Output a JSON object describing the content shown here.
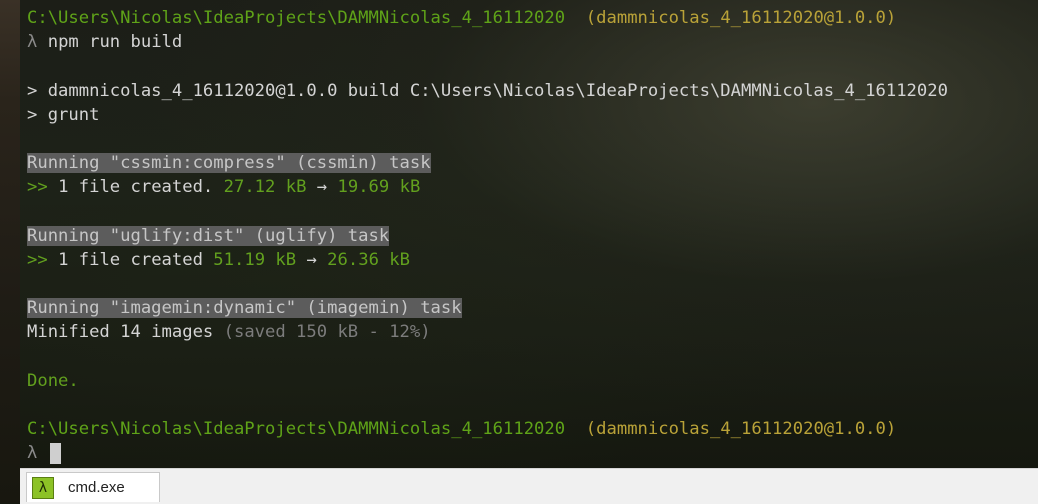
{
  "terminal": {
    "prompt1": {
      "path": "C:\\Users\\Nicolas\\IdeaProjects\\DAMMNicolas_4_16112020",
      "pkg": "(dammnicolas_4_16112020@1.0.0)"
    },
    "command": {
      "lambda": "λ",
      "text": "npm run build"
    },
    "build_line": "> dammnicolas_4_16112020@1.0.0 build C:\\Users\\Nicolas\\IdeaProjects\\DAMMNicolas_4_16112020",
    "grunt_line": "> grunt",
    "task1": {
      "header": "Running \"cssmin:compress\" (cssmin) task",
      "prefix": ">>",
      "message": "1 file created.",
      "from": "27.12 kB",
      "arrow": "→",
      "to": "19.69 kB"
    },
    "task2": {
      "header": "Running \"uglify:dist\" (uglify) task",
      "prefix": ">>",
      "message": "1 file created",
      "from": "51.19 kB",
      "arrow": "→",
      "to": "26.36 kB"
    },
    "task3": {
      "header": "Running \"imagemin:dynamic\" (imagemin) task",
      "message": "Minified 14 images",
      "saved": "(saved 150 kB - 12%)"
    },
    "done": "Done.",
    "prompt2": {
      "path": "C:\\Users\\Nicolas\\IdeaProjects\\DAMMNicolas_4_16112020",
      "pkg": "(dammnicolas_4_16112020@1.0.0)"
    },
    "cursor_prompt": {
      "lambda": "λ"
    }
  },
  "taskbar": {
    "tab_label": "cmd.exe",
    "tab_icon_glyph": "λ",
    "tab_icon_name": "lambda-console-icon"
  },
  "colors": {
    "path_green": "#5fa318",
    "package_yellow": "#b9a238",
    "task_highlight": "#5c5c5c"
  }
}
